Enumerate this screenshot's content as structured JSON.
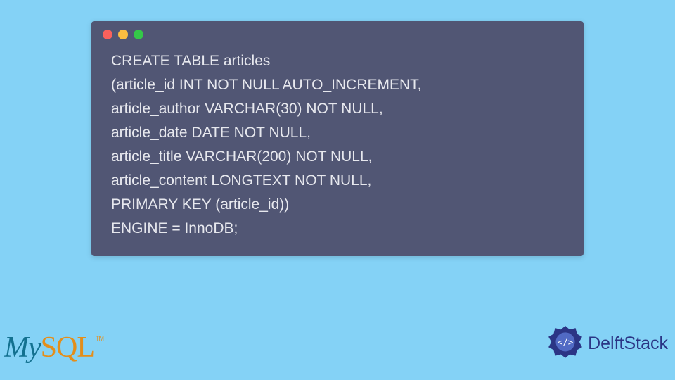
{
  "window": {
    "dots": [
      "#fa615c",
      "#fcbd41",
      "#34c848"
    ]
  },
  "code": {
    "lines": [
      "CREATE TABLE articles",
      "(article_id INT NOT NULL AUTO_INCREMENT,",
      "article_author VARCHAR(30) NOT NULL,",
      "article_date DATE NOT NULL,",
      "article_title VARCHAR(200) NOT NULL,",
      "article_content LONGTEXT NOT NULL,",
      "PRIMARY KEY (article_id))",
      "ENGINE = InnoDB;"
    ]
  },
  "logos": {
    "mysql": {
      "part1": "My",
      "part2": "SQL",
      "tm": "TM"
    },
    "delft": {
      "text": "DelftStack"
    }
  }
}
